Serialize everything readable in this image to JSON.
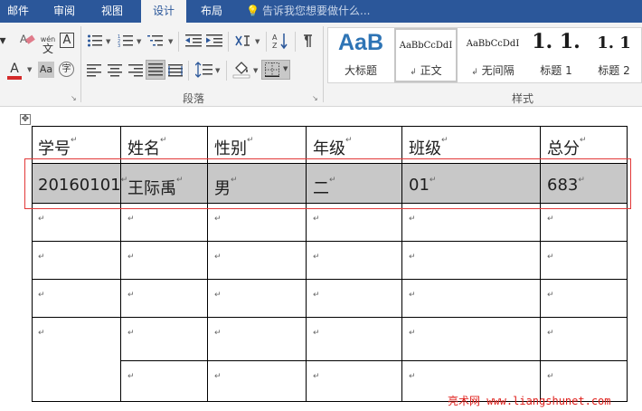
{
  "tabs": [
    {
      "label": "邮件",
      "active": false
    },
    {
      "label": "审阅",
      "active": false
    },
    {
      "label": "视图",
      "active": false
    },
    {
      "label": "设计",
      "active": true
    },
    {
      "label": "布局",
      "active": false
    }
  ],
  "tell_me": {
    "text": "告诉我您想要做什么..."
  },
  "ribbon": {
    "font_group": {
      "clear_format_icon": "eraser-A-icon",
      "phonetic_icon": "wen-phonetic-icon",
      "phonetic_text": "wén",
      "phonetic_char": "文",
      "char_border_char": "A",
      "font_color_char": "A",
      "font_color": "#d42a2a",
      "char_shading_char": "Aa",
      "enclose_char": "字"
    },
    "paragraph_group": {
      "label": "段落"
    },
    "styles_group": {
      "label": "样式",
      "items": [
        {
          "preview": "AaB",
          "name": "大标题",
          "selected": false
        },
        {
          "preview": "AaBbCcDdI",
          "name": "正文",
          "selected": true
        },
        {
          "preview": "AaBbCcDdI",
          "name": "无间隔",
          "selected": false
        },
        {
          "preview": "1. 1.",
          "name": "标题 1",
          "selected": false
        },
        {
          "preview": "1. 1",
          "name": "标题 2",
          "selected": false
        }
      ],
      "paragraph_mark": "↲"
    }
  },
  "document": {
    "table": {
      "headers": [
        "学号",
        "姓名",
        "性别",
        "年级",
        "班级",
        "总分"
      ],
      "rows": [
        [
          "20160101",
          "王际禹",
          "男",
          "二",
          "01",
          "683"
        ]
      ],
      "empty_row_count": 5,
      "selected_row": 0,
      "end_of_cell_mark": "↵"
    },
    "watermark": "亮术网 www.liangshunet.com"
  },
  "colors": {
    "accent": "#2b579a",
    "selection_border": "#e23838",
    "row_shade": "#c8c8c8",
    "watermark": "#e0201c"
  }
}
